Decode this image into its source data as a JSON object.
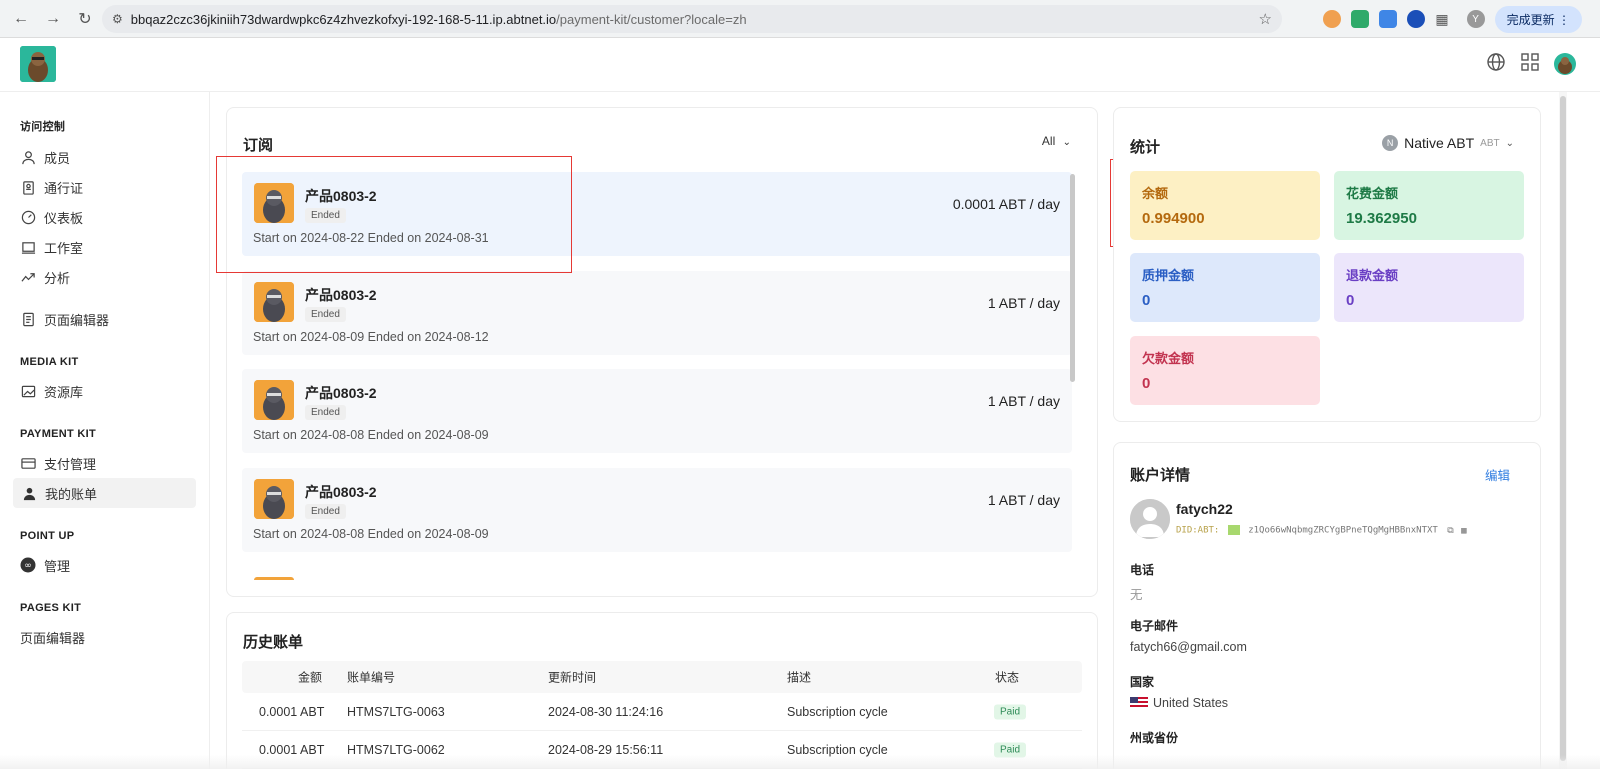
{
  "browser": {
    "url_host": "bbqaz2czc36jkiniih73dwardwpkc6z4zhvezkofxyi-192-168-5-11.ip.abtnet.io",
    "url_path": "/payment-kit/customer?locale=zh",
    "update_label": "完成更新",
    "profile_initial": "Y"
  },
  "sidebar": {
    "sections": [
      {
        "title": "访问控制",
        "items": [
          "成员",
          "通行证",
          "仪表板",
          "工作室",
          "分析"
        ]
      },
      {
        "extra": "页面编辑器"
      },
      {
        "title": "MEDIA KIT",
        "items": [
          "资源库"
        ]
      },
      {
        "title": "PAYMENT KIT",
        "items": [
          "支付管理",
          "我的账单"
        ]
      },
      {
        "title": "POINT UP",
        "items": [
          "管理"
        ]
      },
      {
        "title": "PAGES KIT",
        "items": [
          "页面编辑器"
        ]
      }
    ]
  },
  "subscriptions": {
    "title": "订阅",
    "filter": "All",
    "rows": [
      {
        "name": "产品0803-2",
        "status": "Ended",
        "dates": "Start on 2024-08-22 Ended on 2024-08-31",
        "price": "0.0001 ABT / day"
      },
      {
        "name": "产品0803-2",
        "status": "Ended",
        "dates": "Start on 2024-08-09 Ended on 2024-08-12",
        "price": "1 ABT / day"
      },
      {
        "name": "产品0803-2",
        "status": "Ended",
        "dates": "Start on 2024-08-08 Ended on 2024-08-09",
        "price": "1 ABT / day"
      },
      {
        "name": "产品0803-2",
        "status": "Ended",
        "dates": "Start on 2024-08-08 Ended on 2024-08-09",
        "price": "1 ABT / day"
      }
    ]
  },
  "history": {
    "title": "历史账单",
    "headers": [
      "金额",
      "账单编号",
      "更新时间",
      "描述",
      "状态"
    ],
    "rows": [
      {
        "amount": "0.0001 ABT",
        "number": "HTMS7LTG-0063",
        "time": "2024-08-30 11:24:16",
        "desc": "Subscription cycle",
        "status": "Paid"
      },
      {
        "amount": "0.0001 ABT",
        "number": "HTMS7LTG-0062",
        "time": "2024-08-29 15:56:11",
        "desc": "Subscription cycle",
        "status": "Paid"
      }
    ]
  },
  "stats": {
    "title": "统计",
    "currency": "Native ABT",
    "currency_symbol": "ABT",
    "tiles": [
      {
        "label": "余额",
        "value": "0.994900",
        "bg": "#fdf0c4",
        "fg": "#b4690e"
      },
      {
        "label": "花费金额",
        "value": "19.362950",
        "bg": "#d8f5e2",
        "fg": "#1e7a46"
      },
      {
        "label": "质押金额",
        "value": "0",
        "bg": "#dde8fb",
        "fg": "#2b5fc4"
      },
      {
        "label": "退款金额",
        "value": "0",
        "bg": "#ece6fb",
        "fg": "#6a3fc4"
      },
      {
        "label": "欠款金额",
        "value": "0",
        "bg": "#fde0e4",
        "fg": "#c2334f"
      }
    ]
  },
  "account": {
    "title": "账户详情",
    "edit": "编辑",
    "name": "fatych22",
    "did_prefix": "DID:ABT:",
    "did": "z1Qo66wNqbmgZRCYgBPneTQgMgHBBnxNTXT",
    "phone_label": "电话",
    "phone": "无",
    "email_label": "电子邮件",
    "email": "fatych66@gmail.com",
    "country_label": "国家",
    "country": "United States",
    "state_label": "州或省份"
  }
}
